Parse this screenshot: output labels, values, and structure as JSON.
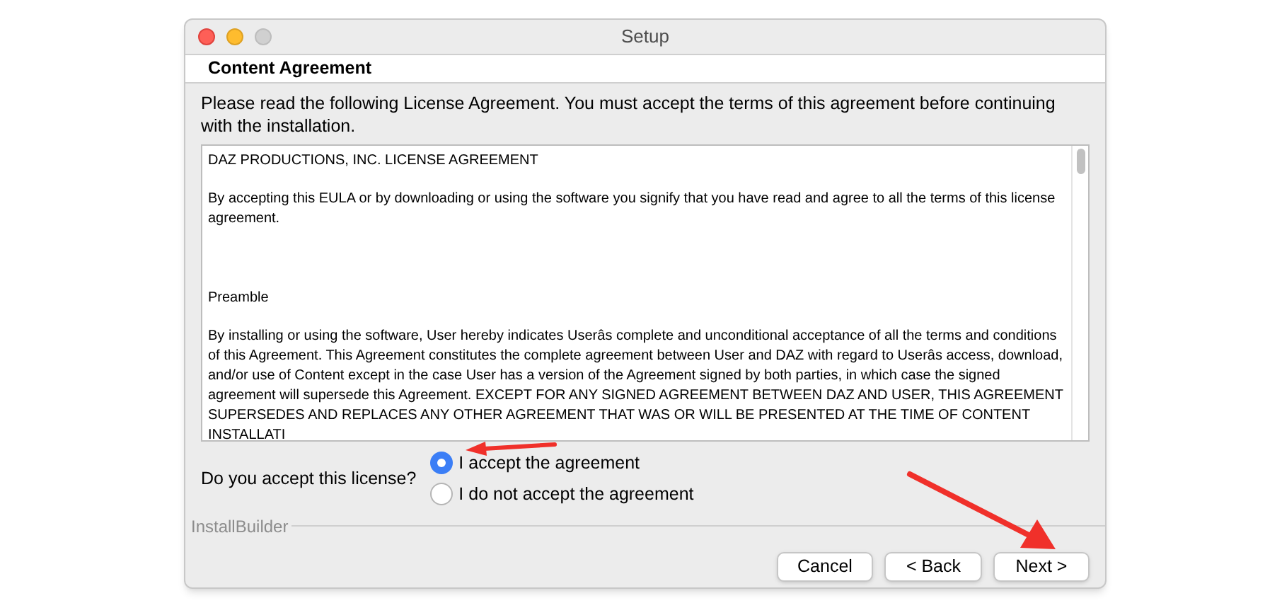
{
  "window": {
    "title": "Setup"
  },
  "header": {
    "title": "Content Agreement"
  },
  "instructions": "Please read the following License Agreement. You must accept the terms of this agreement before continuing with the installation.",
  "license_text": [
    "DAZ PRODUCTIONS, INC. LICENSE AGREEMENT",
    "By accepting this EULA or by downloading or using the software you signify that you have read and agree to all the terms of this license agreement.",
    "Preamble",
    "By installing or using the software, User hereby indicates Userâs complete and unconditional acceptance of all the terms and conditions of this Agreement. This Agreement constitutes the complete agreement between User and DAZ with regard to Userâs access, download, and/or use of Content except in the case User has a version of the Agreement signed by both parties, in which case the signed agreement will supersede this Agreement. EXCEPT FOR ANY SIGNED AGREEMENT BETWEEN DAZ AND USER, THIS AGREEMENT SUPERSEDES AND REPLACES ANY OTHER AGREEMENT THAT WAS OR WILL BE PRESENTED AT THE TIME OF CONTENT INSTALLATI"
  ],
  "question": "Do you accept this license?",
  "options": [
    {
      "label": "I accept the agreement",
      "selected": true
    },
    {
      "label": "I do not accept the agreement",
      "selected": false
    }
  ],
  "brand": "InstallBuilder",
  "buttons": [
    "Cancel",
    "< Back",
    "Next >"
  ]
}
